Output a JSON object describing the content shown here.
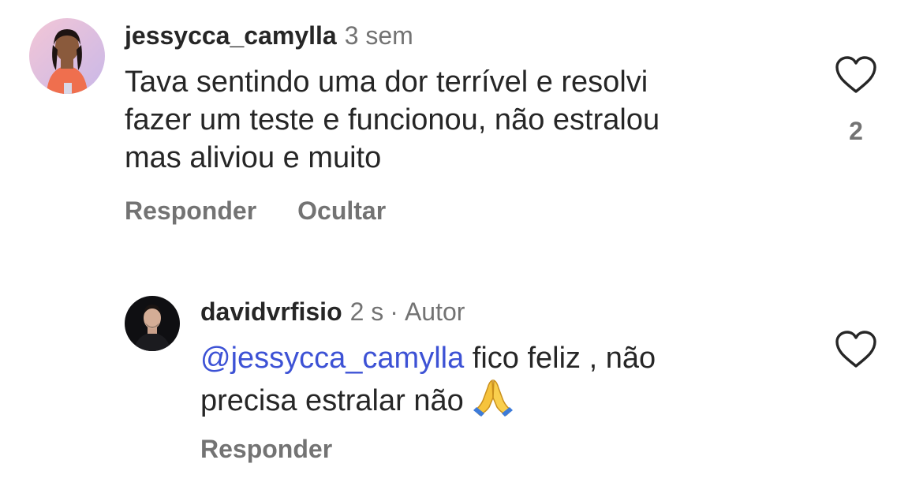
{
  "comments": [
    {
      "username": "jessycca_camylla",
      "time": "3 sem",
      "body_lines": [
        "Tava sentindo uma dor terrível e resolvi",
        "fazer um teste e funcionou, não estralou",
        "mas aliviou e muito"
      ],
      "actions": {
        "reply": "Responder",
        "hide": "Ocultar"
      },
      "like_icon": "heart-outline-icon",
      "like_count": "2"
    }
  ],
  "reply": {
    "username": "davidvrfisio",
    "time": "2 s",
    "separator": "·",
    "author_badge": "Autor",
    "mention": "@jessycca_camylla",
    "body_line1_rest": " fico feliz , não",
    "body_line2": "precisa estralar não ",
    "emoji": "folded-hands-emoji",
    "actions": {
      "reply": "Responder"
    },
    "like_icon": "heart-outline-icon"
  },
  "colors": {
    "text": "#262626",
    "secondary": "#737373",
    "mention": "#3d52d5"
  }
}
